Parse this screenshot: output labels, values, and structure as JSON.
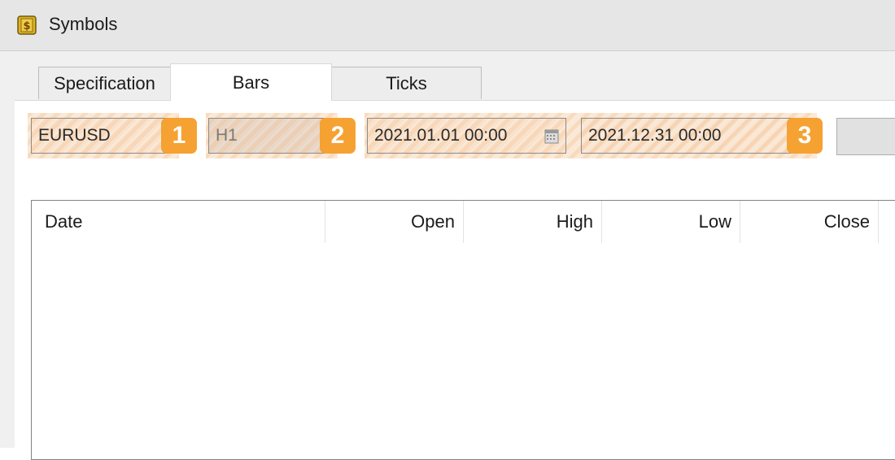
{
  "window": {
    "title": "Symbols",
    "title_icon": "dollar-symbols-icon"
  },
  "tabs": [
    {
      "label": "Specification",
      "active": false
    },
    {
      "label": "Bars",
      "active": true
    },
    {
      "label": "Ticks",
      "active": false
    }
  ],
  "controls": {
    "symbol": {
      "value": "EURUSD"
    },
    "timeframe": {
      "value": "H1"
    },
    "date_from": {
      "value": "2021.01.01 00:00",
      "icon": "calendar-icon"
    },
    "date_to": {
      "value": "2021.12.31 00:00"
    }
  },
  "badges": [
    "1",
    "2",
    "3"
  ],
  "table": {
    "columns": [
      "Date",
      "Open",
      "High",
      "Low",
      "Close"
    ],
    "rows": []
  },
  "colors": {
    "badge": "#f5a232",
    "highlight": "#fbe9d7"
  }
}
